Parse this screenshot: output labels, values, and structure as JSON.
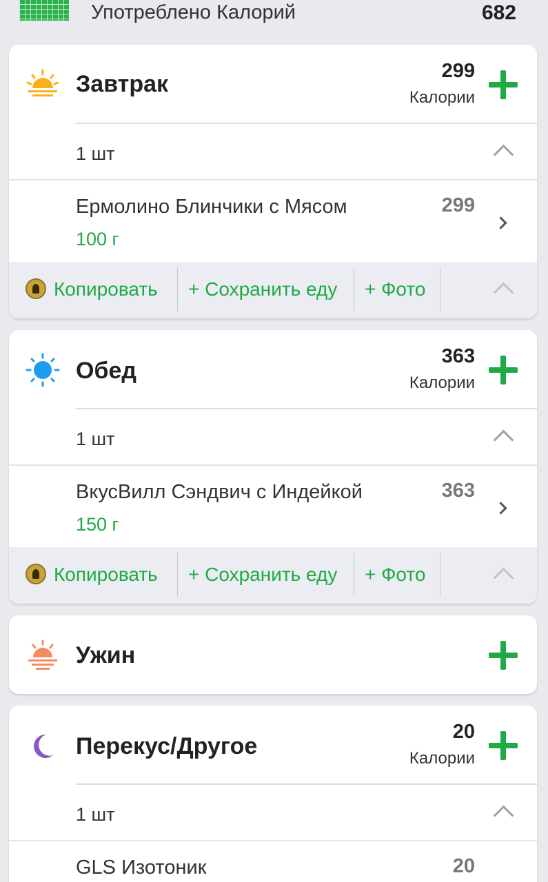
{
  "summary": {
    "label": "Употреблено Калорий",
    "total": "682"
  },
  "colors": {
    "accent": "#1faa45",
    "background": "#e9e9ee"
  },
  "meals": [
    {
      "name": "Завтрак",
      "icon": "sunrise-icon",
      "calories": "299",
      "calories_label": "Калории",
      "quantity": "1 шт",
      "food": {
        "name": "Ермолино Блинчики с Мясом",
        "amount": "100 г",
        "calories": "299"
      },
      "actions": {
        "copy": "Копировать",
        "save": "+ Сохранить еду",
        "photo": "+ Фото"
      }
    },
    {
      "name": "Обед",
      "icon": "sun-icon",
      "calories": "363",
      "calories_label": "Калории",
      "quantity": "1 шт",
      "food": {
        "name": "ВкусВилл Сэндвич с Индейкой",
        "amount": "150 г",
        "calories": "363"
      },
      "actions": {
        "copy": "Копировать",
        "save": "+ Сохранить еду",
        "photo": "+ Фото"
      }
    },
    {
      "name": "Ужин",
      "icon": "sunset-icon"
    },
    {
      "name": "Перекус/Другое",
      "icon": "moon-icon",
      "calories": "20",
      "calories_label": "Калории",
      "quantity": "1 шт",
      "food": {
        "name": "GLS Изотоник",
        "calories": "20"
      }
    }
  ]
}
